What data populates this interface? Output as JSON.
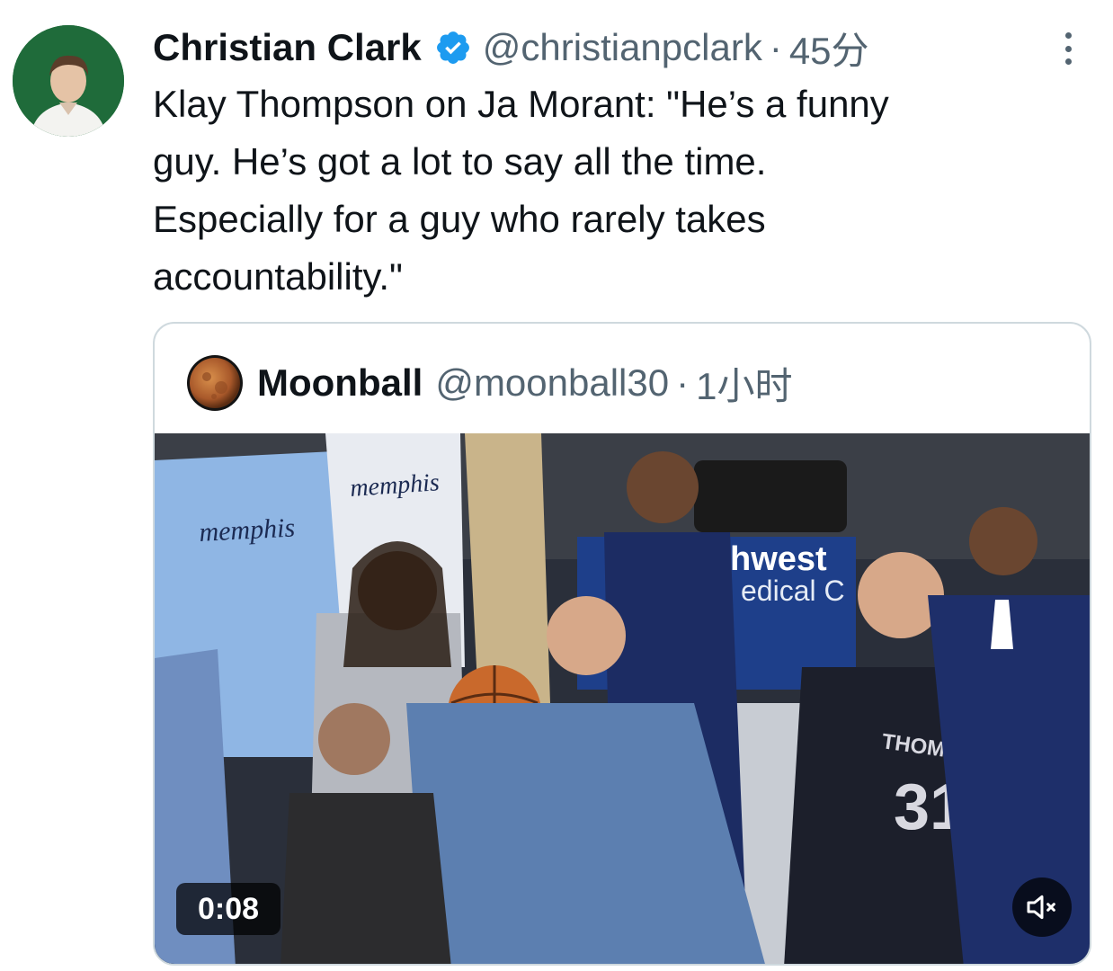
{
  "tweet": {
    "author": {
      "display_name": "Christian Clark",
      "handle": "@christianpclark",
      "verified": true,
      "time": "45分"
    },
    "text": "Klay Thompson on Ja Morant: \"He’s a funny\nguy. He’s got a lot to say all the time.\nEspecially for a guy who rarely takes\naccountability.\"",
    "more_icon": "more-dots-icon",
    "quoted": {
      "display_name": "Moonball",
      "handle": "@moonball30",
      "time": "1小时",
      "media": {
        "type": "video",
        "duration": "0:08",
        "mute_icon": "muted-speaker-icon",
        "jersey_texts": [
          "memphis",
          "memphis",
          "THOMPSON",
          "31"
        ],
        "board_texts": [
          "hwest",
          "edical C"
        ]
      }
    }
  },
  "colors": {
    "text": "#0f1419",
    "secondary": "#536471",
    "verified": "#1d9bf0",
    "border": "#cfd9de",
    "avatar_bg": "#1f6b3a"
  }
}
